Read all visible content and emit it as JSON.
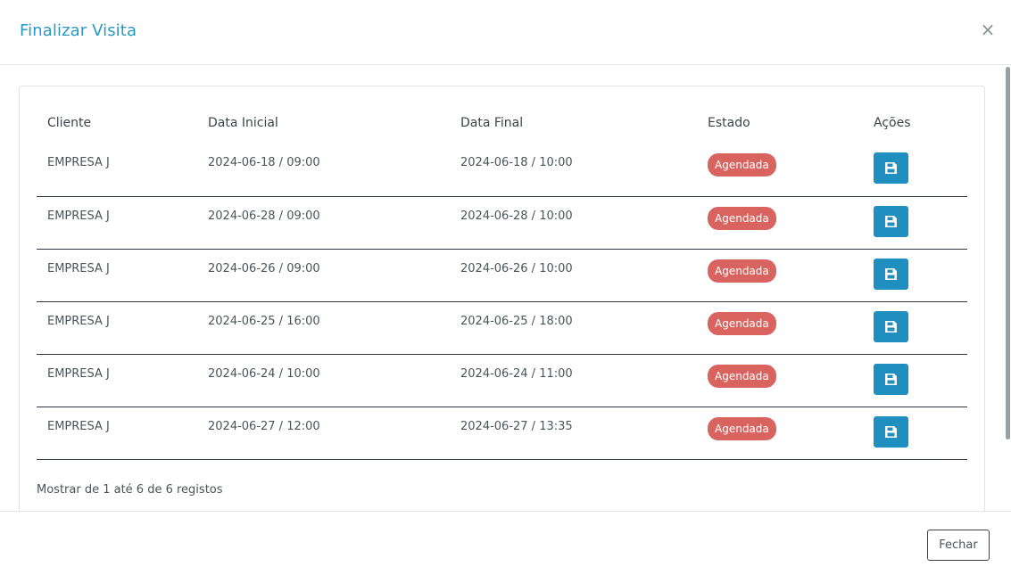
{
  "modal": {
    "title": "Finalizar Visita",
    "close_icon": "×",
    "footer_button": "Fechar"
  },
  "table": {
    "headers": [
      "Cliente",
      "Data Inicial",
      "Data Final",
      "Estado",
      "Ações"
    ],
    "rows": [
      {
        "cliente": "EMPRESA J",
        "data_inicial": "2024-06-18 / 09:00",
        "data_final": "2024-06-18 / 10:00",
        "estado": "Agendada"
      },
      {
        "cliente": "EMPRESA J",
        "data_inicial": "2024-06-28 / 09:00",
        "data_final": "2024-06-28 / 10:00",
        "estado": "Agendada"
      },
      {
        "cliente": "EMPRESA J",
        "data_inicial": "2024-06-26 / 09:00",
        "data_final": "2024-06-26 / 10:00",
        "estado": "Agendada"
      },
      {
        "cliente": "EMPRESA J",
        "data_inicial": "2024-06-25 / 16:00",
        "data_final": "2024-06-25 / 18:00",
        "estado": "Agendada"
      },
      {
        "cliente": "EMPRESA J",
        "data_inicial": "2024-06-24 / 10:00",
        "data_final": "2024-06-24 / 11:00",
        "estado": "Agendada"
      },
      {
        "cliente": "EMPRESA J",
        "data_inicial": "2024-06-27 / 12:00",
        "data_final": "2024-06-27 / 13:35",
        "estado": "Agendada"
      }
    ],
    "action_icon": "save-icon",
    "info": "Mostrar de 1 até 6 de 6 registos"
  },
  "colors": {
    "title": "#2a97c4",
    "badge": "#d9635f",
    "action_button": "#1f8fbf"
  }
}
